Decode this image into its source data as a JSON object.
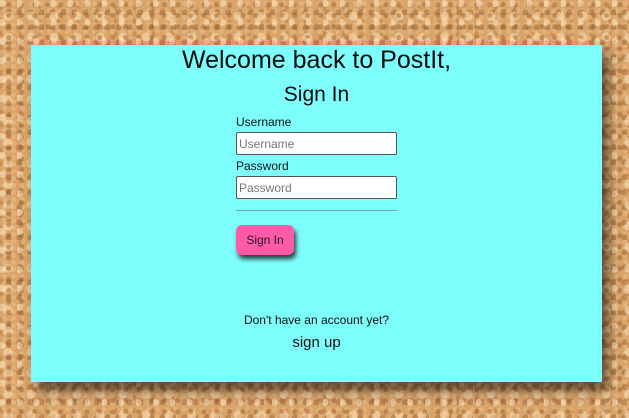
{
  "page": {
    "title": "Welcome back to PostIt,",
    "subtitle": "Sign In"
  },
  "form": {
    "username_label": "Username",
    "username_placeholder": "Username",
    "username_value": "",
    "password_label": "Password",
    "password_placeholder": "Password",
    "password_value": "",
    "submit_label": "Sign In"
  },
  "footer": {
    "prompt": "Don't have an account yet?",
    "signup_label": "sign up"
  },
  "colors": {
    "card_background": "#7dfdfc",
    "button_background": "#ff5aa8",
    "page_background": "#d9a46a"
  }
}
